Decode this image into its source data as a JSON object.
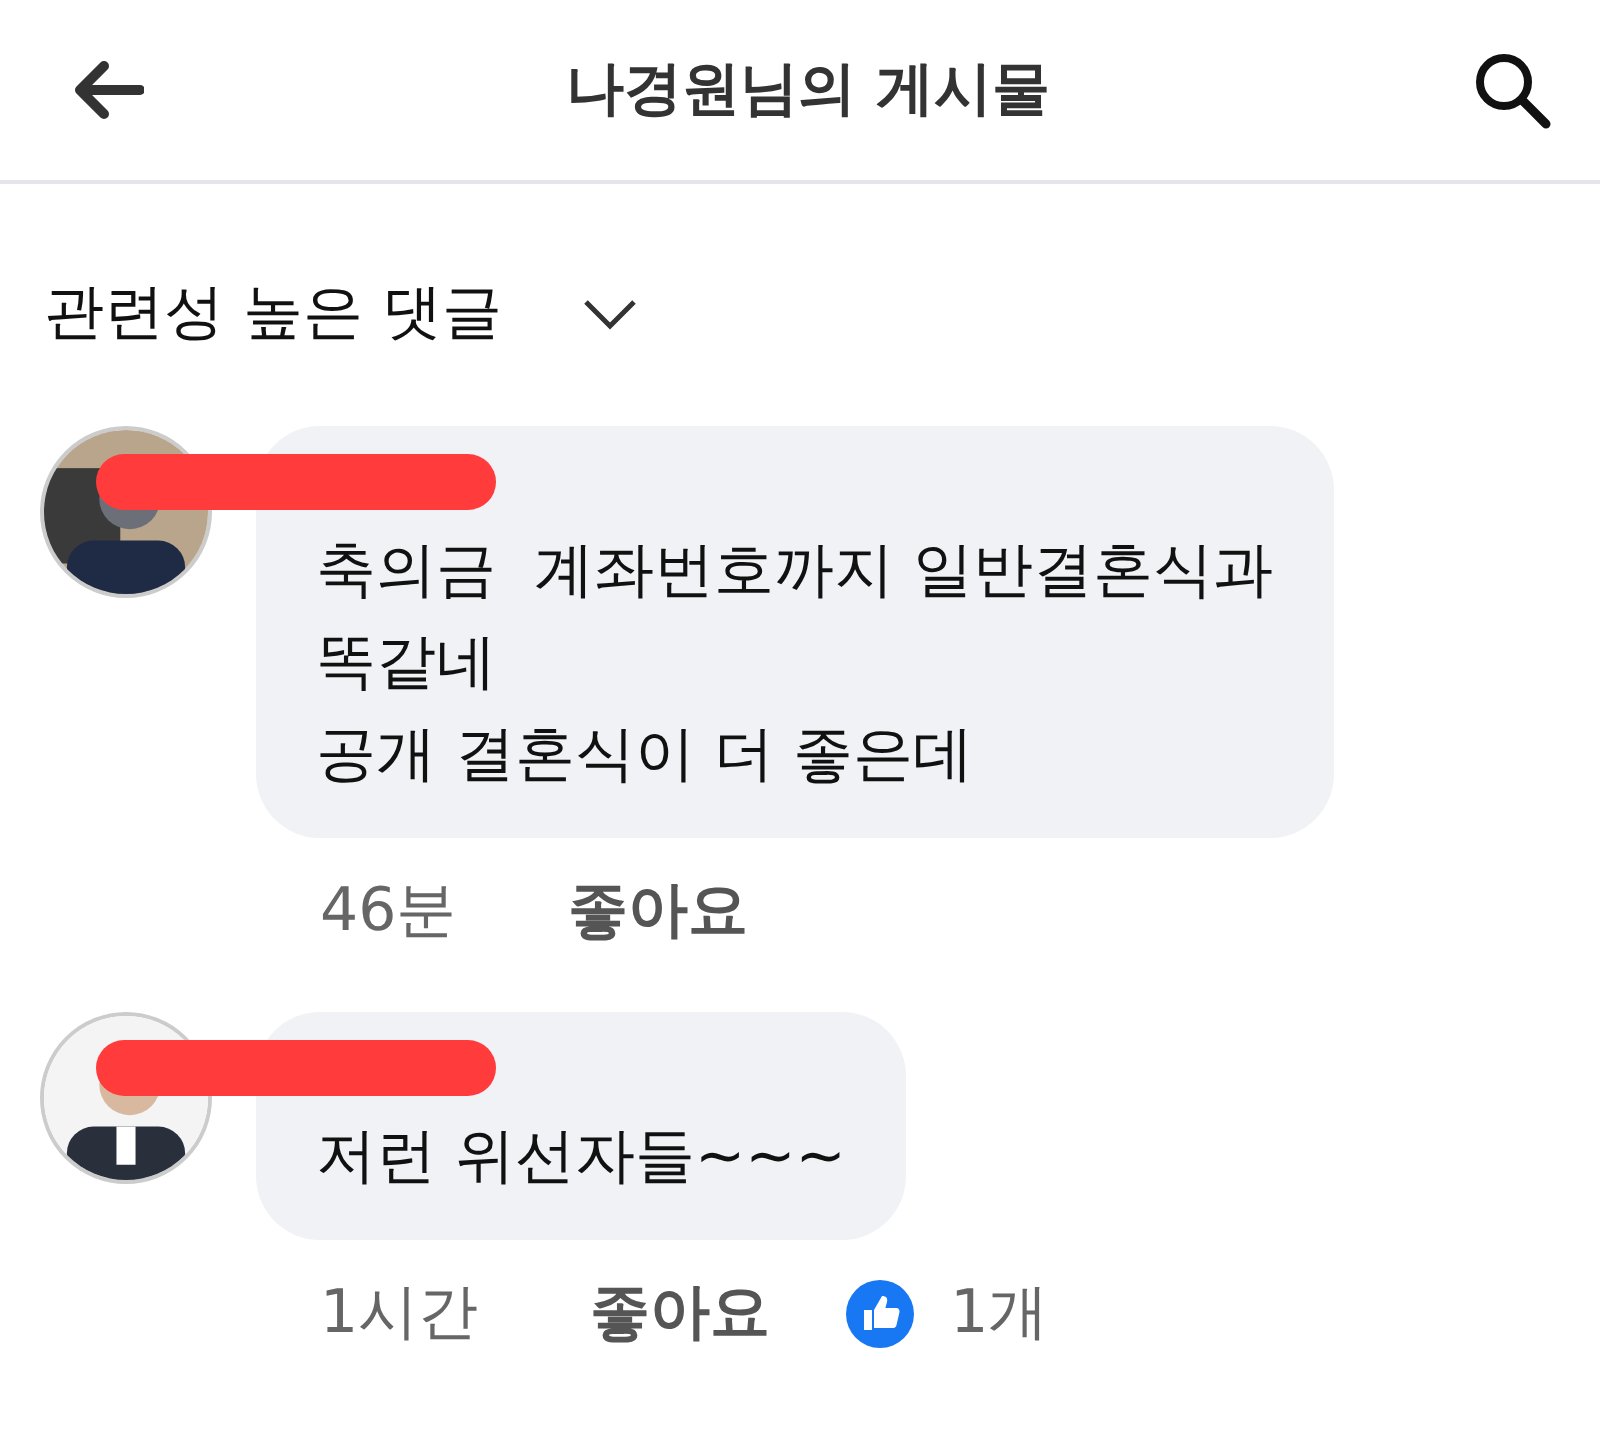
{
  "header": {
    "title": "나경원님의 게시물"
  },
  "sort": {
    "label": "관련성 높은 댓글"
  },
  "comments": [
    {
      "text": "축의금  계좌번호까지 일반결혼식과\n똑같네\n공개 결혼식이 더 좋은데",
      "time": "46분",
      "like": "좋아요"
    },
    {
      "text": "저런 위선자들~~~",
      "time": "1시간",
      "like": "좋아요",
      "reaction_count": "1개"
    }
  ]
}
